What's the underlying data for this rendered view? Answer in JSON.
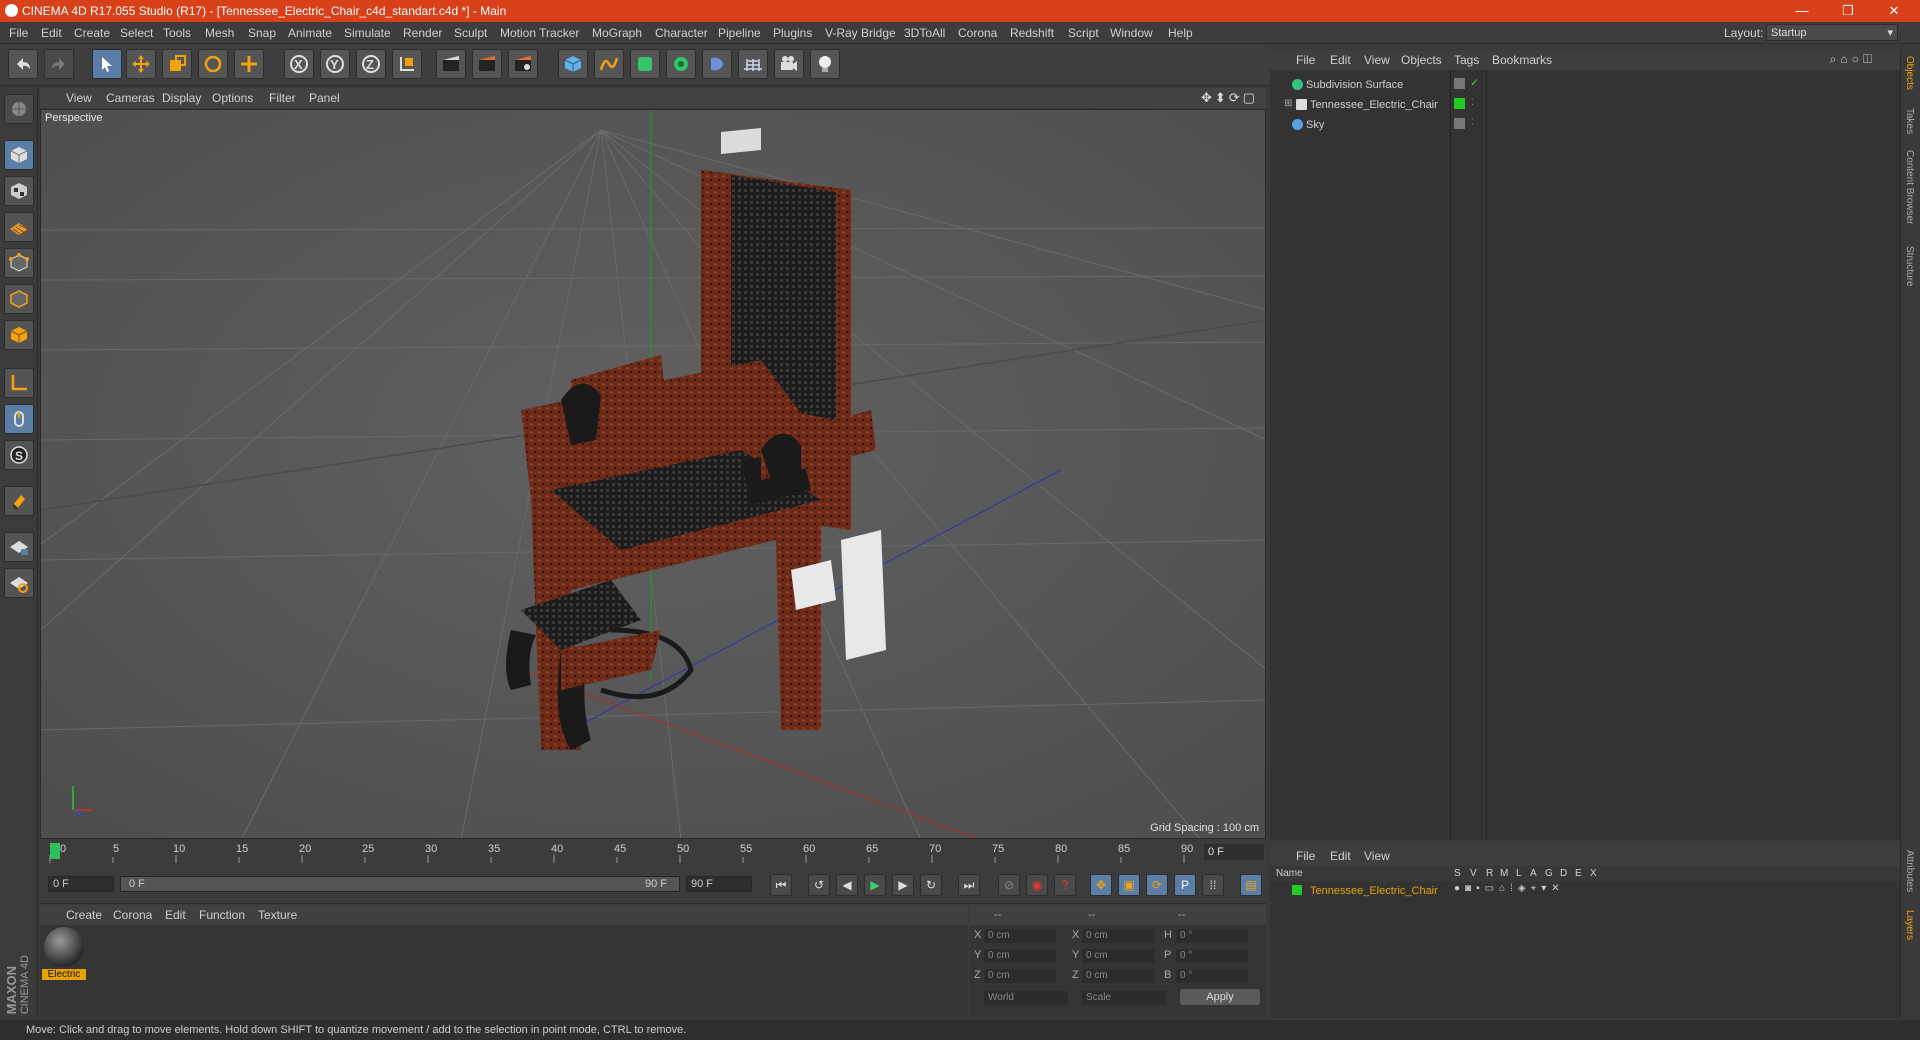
{
  "titlebar": {
    "title": "CINEMA 4D R17.055 Studio (R17) - [Tennessee_Electric_Chair_c4d_standart.c4d *] - Main",
    "minimize": "—",
    "restore": "❐",
    "close": "✕"
  },
  "menubar": {
    "items": [
      "File",
      "Edit",
      "Create",
      "Select",
      "Tools",
      "Mesh",
      "Snap",
      "Animate",
      "Simulate",
      "Render",
      "Sculpt",
      "Motion Tracker",
      "MoGraph",
      "Character",
      "Pipeline",
      "Plugins",
      "V-Ray Bridge",
      "3DToAll",
      "Corona",
      "Redshift",
      "Script",
      "Window",
      "Help"
    ],
    "layout_label": "Layout:",
    "layout_value": "Startup"
  },
  "viewport": {
    "menu": [
      "View",
      "Cameras",
      "Display",
      "Options",
      "Filter",
      "Panel"
    ],
    "label": "Perspective",
    "grid_spacing": "Grid Spacing : 100 cm"
  },
  "timeline": {
    "ticks": [
      "0",
      "5",
      "10",
      "15",
      "20",
      "25",
      "30",
      "35",
      "40",
      "45",
      "50",
      "55",
      "60",
      "65",
      "70",
      "75",
      "80",
      "85",
      "90"
    ],
    "current_frame": "0 F",
    "start_field": "0 F",
    "range_start": "0 F",
    "range_end": "90 F",
    "end_field": "90 F"
  },
  "material_manager": {
    "menu": [
      "Create",
      "Corona",
      "Edit",
      "Function",
      "Texture"
    ],
    "material_name": "Electric"
  },
  "coordinates": {
    "header": [
      "--",
      "--",
      "--"
    ],
    "rows": [
      {
        "a": "X",
        "av": "0 cm",
        "b": "X",
        "bv": "0 cm",
        "c": "H",
        "cv": "0 °"
      },
      {
        "a": "Y",
        "av": "0 cm",
        "b": "Y",
        "bv": "0 cm",
        "c": "P",
        "cv": "0 °"
      },
      {
        "a": "Z",
        "av": "0 cm",
        "b": "Z",
        "bv": "0 cm",
        "c": "B",
        "cv": "0 °"
      }
    ],
    "mode1": "World",
    "mode2": "Scale",
    "apply": "Apply"
  },
  "object_manager": {
    "menu": [
      "File",
      "Edit",
      "View",
      "Objects",
      "Tags",
      "Bookmarks"
    ],
    "objects": [
      {
        "name": "Subdivision Surface",
        "color": "#35c47a"
      },
      {
        "name": "Tennessee_Electric_Chair",
        "color": "#dddddd"
      },
      {
        "name": "Sky",
        "color": "#5aa0e0"
      }
    ]
  },
  "layer_manager": {
    "menu": [
      "File",
      "Edit",
      "View"
    ],
    "columns": [
      "Name",
      "S",
      "V",
      "R",
      "M",
      "L",
      "A",
      "G",
      "D",
      "E",
      "X"
    ],
    "layers": [
      {
        "name": "Tennessee_Electric_Chair",
        "color": "#22cc22"
      }
    ]
  },
  "side_tabs": [
    "Objects",
    "Takes",
    "Content Browser",
    "Structure"
  ],
  "side_tabs_bottom": [
    "Attributes",
    "Layers"
  ],
  "status": "Move: Click and drag to move elements. Hold down SHIFT to quantize movement / add to the selection in point mode, CTRL to remove.",
  "logo": {
    "brand": "MAXON",
    "product": "CINEMA 4D"
  }
}
